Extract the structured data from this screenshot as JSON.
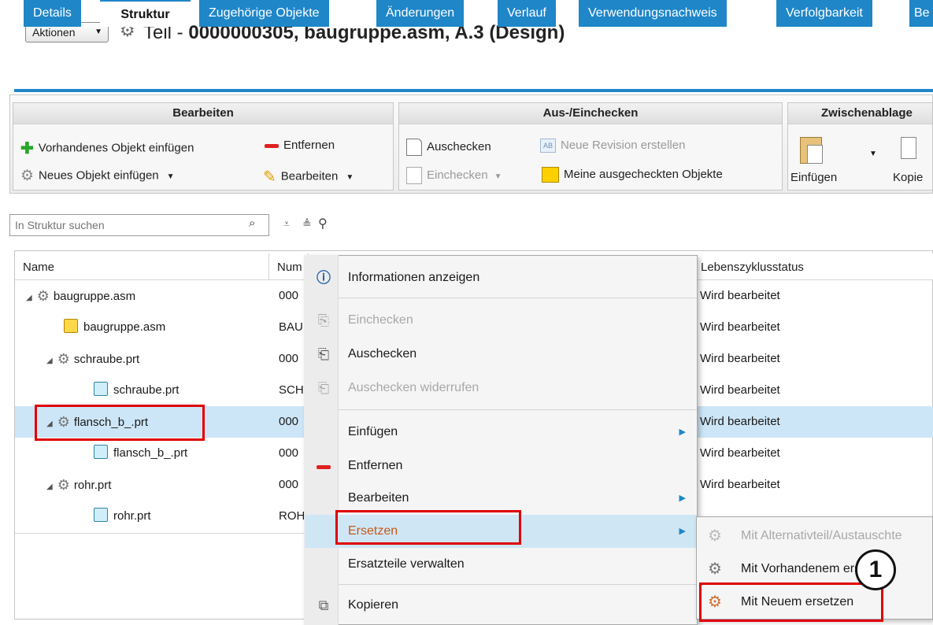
{
  "header": {
    "actions_label": "Aktionen",
    "title_prefix": "Teil - ",
    "title_main": "0000000305, baugruppe.asm, A.3 (Design)"
  },
  "tabs": [
    "Details",
    "Struktur",
    "Zugehörige Objekte",
    "Änderungen",
    "Verlauf",
    "Verwendungsnachweis",
    "Verfolgbarkeit",
    "Be"
  ],
  "ribbon": {
    "bearbeiten": {
      "title": "Bearbeiten",
      "insert_existing": "Vorhandenes Objekt einfügen",
      "remove": "Entfernen",
      "insert_new": "Neues Objekt einfügen",
      "edit": "Bearbeiten"
    },
    "checkin": {
      "title": "Aus-/Einchecken",
      "checkout": "Auschecken",
      "new_revision": "Neue Revision erstellen",
      "checkin": "Einchecken",
      "my_checked_out": "Meine ausgecheckten Objekte"
    },
    "clipboard": {
      "title": "Zwischenablage",
      "paste": "Einfügen",
      "copy": "Kopie"
    }
  },
  "search": {
    "placeholder": "In Struktur suchen"
  },
  "grid": {
    "columns": {
      "name": "Name",
      "number": "Num",
      "lifecycle": "Lebenszyklusstatus"
    },
    "rows": [
      {
        "name": "baugruppe.asm",
        "number": "000",
        "status": "Wird bearbeitet"
      },
      {
        "name": "baugruppe.asm",
        "number": "BAU",
        "status": "Wird bearbeitet"
      },
      {
        "name": "schraube.prt",
        "number": "000",
        "status": "Wird bearbeitet"
      },
      {
        "name": "schraube.prt",
        "number": "SCH",
        "status": "Wird bearbeitet"
      },
      {
        "name": "flansch_b_.prt",
        "number": "000",
        "status": "Wird bearbeitet"
      },
      {
        "name": "flansch_b_.prt",
        "number": "000",
        "status": "Wird bearbeitet"
      },
      {
        "name": "rohr.prt",
        "number": "000",
        "status": "Wird bearbeitet"
      },
      {
        "name": "rohr.prt",
        "number": "ROH",
        "status": ""
      }
    ]
  },
  "context_menu": {
    "info": "Informationen anzeigen",
    "checkin": "Einchecken",
    "checkout": "Auschecken",
    "undo_checkout": "Auschecken widerrufen",
    "paste": "Einfügen",
    "remove": "Entfernen",
    "edit": "Bearbeiten",
    "replace": "Ersetzen",
    "manage_spares": "Ersatzteile verwalten",
    "copy": "Kopieren"
  },
  "submenu": {
    "with_alternate": "Mit Alternativteil/Austauschte",
    "with_existing": "Mit Vorhandenem ersetzen",
    "with_new": "Mit Neuem ersetzen"
  },
  "annotation": {
    "badge": "1"
  },
  "colors": {
    "tab_blue": "#1f86c8",
    "highlight_red": "#e00000",
    "selection_blue": "#cde6f7"
  }
}
